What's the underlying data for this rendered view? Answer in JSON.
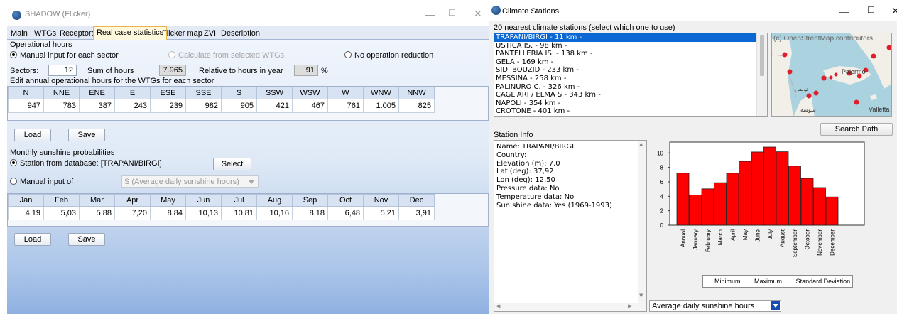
{
  "left_window": {
    "title": "SHADOW (Flicker)",
    "controls": {
      "minimize": "—",
      "maximize": "☐",
      "close": "✕"
    },
    "tabs": [
      "Main",
      "WTGs",
      "Receptors",
      "Real case statistics",
      "Flicker map",
      "ZVI",
      "Description"
    ],
    "active_tab_index": 3,
    "operational": {
      "heading": "Operational hours",
      "opt_manual": "Manual input for each sector",
      "opt_calc": "Calculate from selected WTGs",
      "opt_none": "No operation reduction",
      "sectors_label": "Sectors:",
      "sectors_value": "12",
      "sum_label": "Sum of hours",
      "sum_value": "7.965",
      "relative_label": "Relative to hours in year",
      "relative_value": "91",
      "percent": "%",
      "edit_label": "Edit annual operational hours for the WTGs for each sector",
      "headers": [
        "N",
        "NNE",
        "ENE",
        "E",
        "ESE",
        "SSE",
        "S",
        "SSW",
        "WSW",
        "W",
        "WNW",
        "NNW"
      ],
      "values": [
        "947",
        "783",
        "387",
        "243",
        "239",
        "982",
        "905",
        "421",
        "467",
        "761",
        "1.005",
        "825"
      ],
      "load": "Load",
      "save": "Save"
    },
    "sunshine": {
      "heading": "Monthly sunshine probabilities",
      "opt_station": "Station from database: [TRAPANI/BIRGI]",
      "select": "Select",
      "opt_manual": "Manual input of",
      "combo": "S (Average daily sunshine hours)",
      "headers": [
        "Jan",
        "Feb",
        "Mar",
        "Apr",
        "May",
        "Jun",
        "Jul",
        "Aug",
        "Sep",
        "Oct",
        "Nov",
        "Dec"
      ],
      "values": [
        "4,19",
        "5,03",
        "5,88",
        "7,20",
        "8,84",
        "10,13",
        "10,81",
        "10,16",
        "8,18",
        "6,48",
        "5,21",
        "3,91"
      ],
      "load": "Load",
      "save": "Save"
    }
  },
  "right_window": {
    "title": "Climate Stations",
    "controls": {
      "minimize": "—",
      "maximize": "☐",
      "close": "✕"
    },
    "list_label": "20 nearest climate stations (select which one to use)",
    "stations": [
      "TRAPANI/BIRGI - 11 km -",
      "USTICA IS. - 98 km -",
      "PANTELLERIA IS. - 138 km -",
      "GELA - 169 km -",
      "SIDI BOUZID - 233 km -",
      "MESSINA - 258 km -",
      "PALINURO C. - 326 km -",
      "CAGLIARI / ELMA S - 343 km -",
      "NAPOLI - 354 km -",
      "CROTONE - 401 km -"
    ],
    "selected_index": 0,
    "map": {
      "attribution": "(c) OpenStreetMap contributors",
      "city_palermo": "Palermo",
      "city_valletta": "Valletta",
      "label_tunis": "تونس",
      "label_sousse": "سوسة"
    },
    "search_path": "Search Path",
    "info_label": "Station Info",
    "info_lines": [
      "Name: TRAPANI/BIRGI",
      "Country:",
      "Elevation (m): 7,0",
      "Lat (deg): 37,92",
      "Lon (deg): 12,50",
      "Pressure data: No",
      "Temperature data: No",
      "Sun shine data: Yes (1969-1993)"
    ],
    "legend": [
      "Minimum",
      "Maximum",
      "Standard Deviation"
    ],
    "legend_colors": [
      "#1f3f9e",
      "#2e9a4a",
      "#888888"
    ],
    "combo_value": "Average daily sunshine hours"
  },
  "chart_data": {
    "type": "bar",
    "categories": [
      "Annual",
      "January",
      "February",
      "March",
      "April",
      "May",
      "June",
      "July",
      "August",
      "September",
      "October",
      "November",
      "December"
    ],
    "series": [
      {
        "values": [
          7.2,
          4.19,
          5.03,
          5.88,
          7.2,
          8.84,
          10.13,
          10.81,
          10.16,
          8.18,
          6.48,
          5.21,
          3.91
        ]
      }
    ],
    "ylim": [
      0,
      11.5
    ],
    "yticks": [
      0,
      2,
      4,
      6,
      8,
      10
    ],
    "bar_color": "#ff0000",
    "grid": false
  }
}
